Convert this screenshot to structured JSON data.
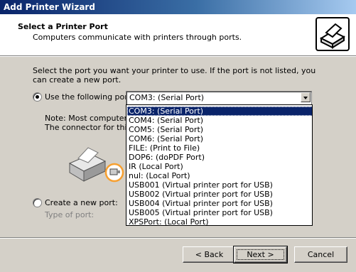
{
  "window": {
    "title": "Add Printer Wizard"
  },
  "header": {
    "title": "Select a Printer Port",
    "subtitle": "Computers communicate with printers through ports."
  },
  "intro_text": "Select the port you want your printer to use.  If the port is not listed, you can create a new port.",
  "use_port": {
    "label": "Use the following port:",
    "selected": true,
    "selected_value": "COM3: (Serial Port)"
  },
  "note": {
    "line1": "Note: Most computers u",
    "line2": "The connector for this p"
  },
  "port_options": [
    "COM3: (Serial Port)",
    "COM4: (Serial Port)",
    "COM5: (Serial Port)",
    "COM6: (Serial Port)",
    "FILE: (Print to File)",
    "DOP6: (doPDF   Port)",
    "IR (Local Port)",
    "nul: (Local Port)",
    "USB001 (Virtual printer port for USB)",
    "USB002 (Virtual printer port for USB)",
    "USB004 (Virtual printer port for USB)",
    "USB005 (Virtual printer port for USB)",
    "XPSPort: (Local Port)"
  ],
  "create_port": {
    "label": "Create a new port:",
    "selected": false,
    "type_label": "Type of port:"
  },
  "buttons": {
    "back": "< Back",
    "next": "Next >",
    "cancel": "Cancel"
  },
  "colors": {
    "title_gradient_start": "#0a246a",
    "title_gradient_end": "#a6caf0",
    "dialog_bg": "#d4d0c8",
    "selection_bg": "#0a246a",
    "highlight_ring": "#f7a030"
  },
  "icons": [
    "printer-wizard-icon",
    "printer-icon",
    "port-connector-icon",
    "dropdown-arrow-icon"
  ]
}
